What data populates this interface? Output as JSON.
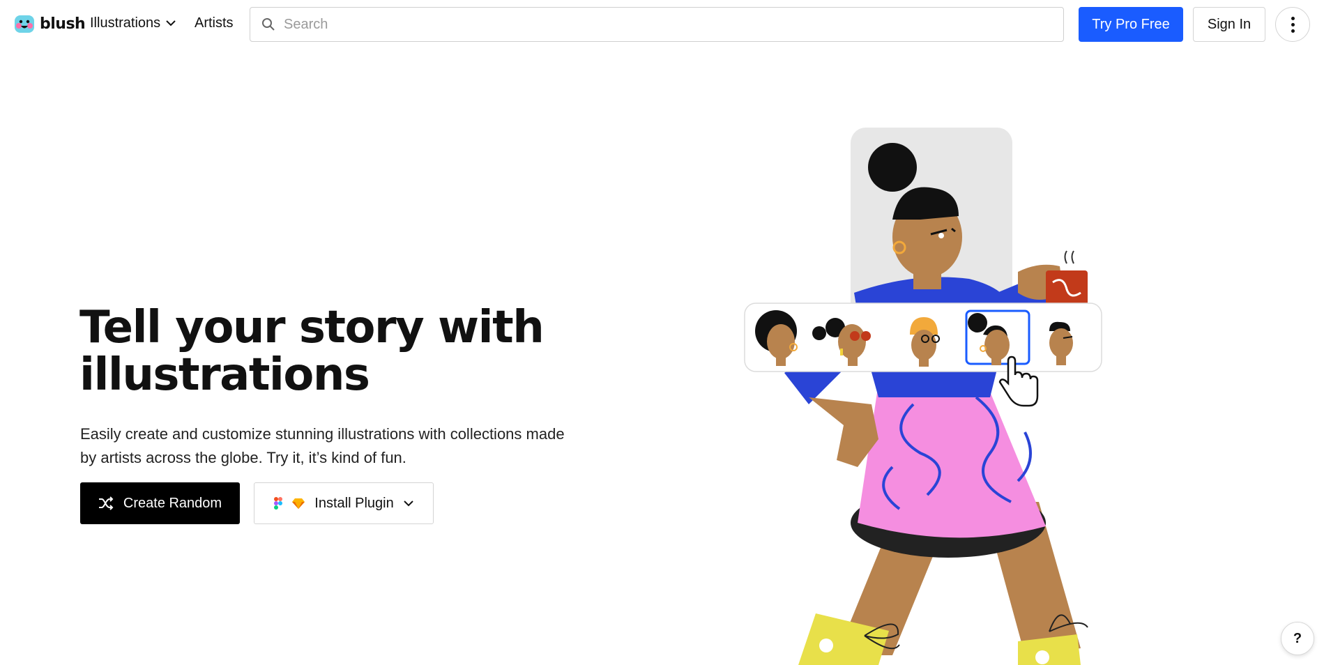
{
  "header": {
    "brand": "blush",
    "nav_illustrations": "Illustrations",
    "nav_artists": "Artists",
    "search_placeholder": "Search",
    "try_pro_label": "Try Pro Free",
    "sign_in_label": "Sign In"
  },
  "hero": {
    "title": "Tell your story with illustrations",
    "subtitle": "Easily create and customize stunning illustrations with collections made by artists across the globe. Try it, it’s kind of fun.",
    "create_random_label": "Create Random",
    "install_plugin_label": "Install Plugin"
  },
  "help": {
    "label": "?"
  },
  "colors": {
    "accent": "#1a5cff",
    "skin": "#b8834e",
    "shirt": "#2a44d6",
    "skirt": "#f58ee0",
    "sock": "#e8e04a"
  },
  "icons": [
    "chevron-down-icon",
    "search-icon",
    "shuffle-icon",
    "figma-icon",
    "sketch-icon",
    "more-vertical-icon",
    "pointer-hand-icon"
  ]
}
